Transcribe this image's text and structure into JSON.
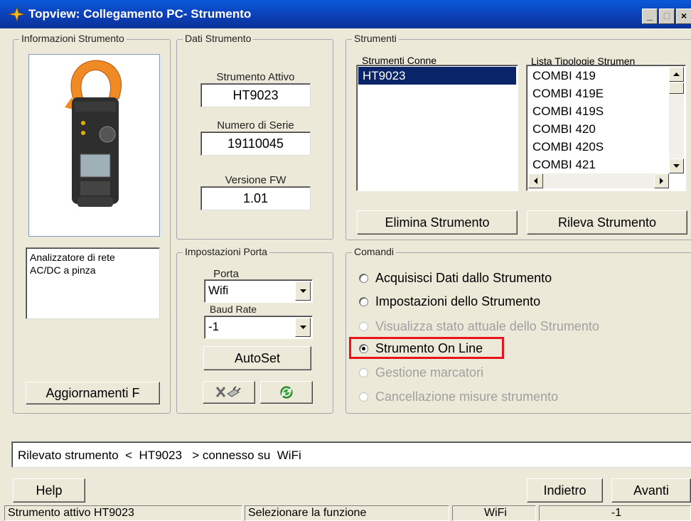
{
  "window": {
    "title": "Topview: Collegamento PC- Strumento",
    "controls": [
      "_",
      "□",
      "×"
    ]
  },
  "info": {
    "label": "Informazioni Strumento",
    "description": "Analizzatore di rete AC/DC a pinza",
    "update_button": "Aggiornamenti F"
  },
  "dati": {
    "label": "Dati Strumento",
    "active_label": "Strumento Attivo",
    "active_value": "HT9023",
    "serial_label": "Numero di Serie",
    "serial_value": "19110045",
    "fw_label": "Versione FW",
    "fw_value": "1.01"
  },
  "strumenti": {
    "label": "Strumenti",
    "connected_header": "Strumenti Conne",
    "connected": [
      "HT9023"
    ],
    "types_header": "Lista Tipologie Strumen",
    "types": [
      "COMBI 419",
      "COMBI 419E",
      "COMBI 419S",
      "COMBI 420",
      "COMBI 420S",
      "COMBI 421"
    ],
    "remove_button": "Elimina Strumento",
    "detect_button": "Rileva Strumento"
  },
  "porta": {
    "label": "Impostazioni Porta",
    "port_label": "Porta",
    "port_value": "Wifi",
    "baud_label": "Baud Rate",
    "baud_value": "-1",
    "autoset_button": "AutoSet"
  },
  "comandi": {
    "label": "Comandi",
    "options": [
      {
        "label": "Acquisisci Dati dallo Strumento",
        "enabled": true,
        "selected": false
      },
      {
        "label": "Impostazioni dello Strumento",
        "enabled": true,
        "selected": false
      },
      {
        "label": "Visualizza stato attuale dello Strumento",
        "enabled": false,
        "selected": false
      },
      {
        "label": "Strumento On Line",
        "enabled": true,
        "selected": true
      },
      {
        "label": "Gestione marcatori",
        "enabled": false,
        "selected": false
      },
      {
        "label": "Cancellazione misure strumento",
        "enabled": false,
        "selected": false
      }
    ],
    "highlight_color": "#e8141c"
  },
  "message": "Rilevato strumento  <  HT9023   > connesso su  WiFi",
  "buttons": {
    "help": "Help",
    "back": "Indietro",
    "next": "Avanti"
  },
  "status": {
    "active": "Strumento attivo HT9023",
    "hint": "Selezionare la funzione",
    "connection": "WiFi",
    "baud": "-1"
  },
  "colors": {
    "title_bar": "#0c3fb8",
    "selection": "#0a246a",
    "window_bg": "#ece9d8"
  }
}
